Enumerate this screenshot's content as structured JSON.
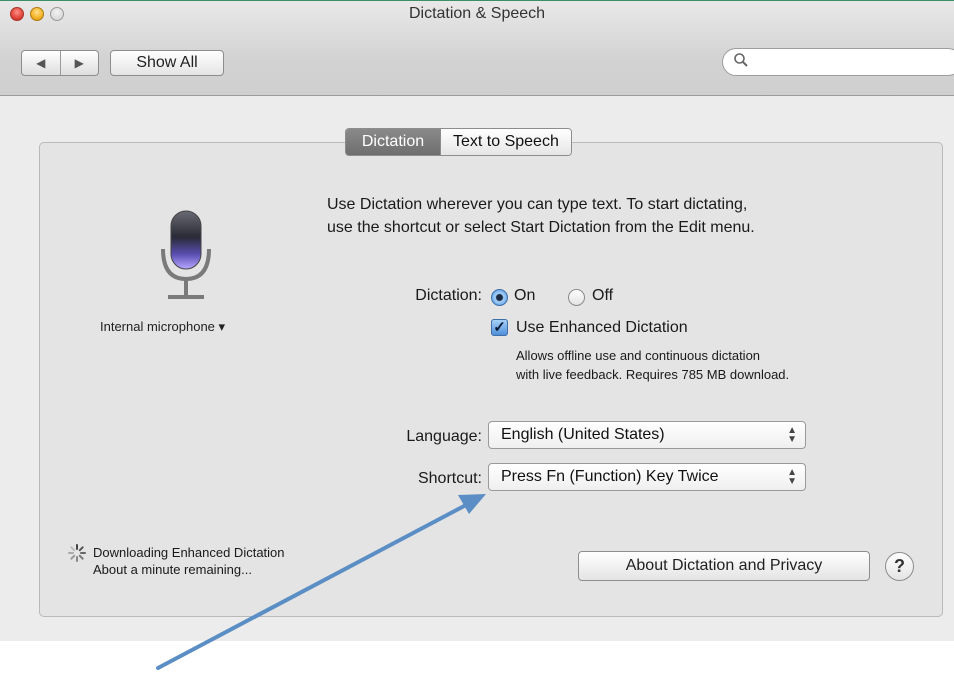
{
  "window": {
    "title": "Dictation & Speech",
    "nav_back_icon": "◀",
    "nav_forward_icon": "▶",
    "show_all_label": "Show All",
    "search": {
      "placeholder": "",
      "icon": "magnifier-icon"
    }
  },
  "tabs": [
    {
      "label": "Dictation",
      "selected": true
    },
    {
      "label": "Text to Speech",
      "selected": false
    }
  ],
  "dictation": {
    "description_line1": "Use Dictation wherever you can type text. To start dictating,",
    "description_line2": "use the shortcut or select Start Dictation from the Edit menu.",
    "microphone_label": "Internal microphone ▾",
    "dictation_label": "Dictation:",
    "on_label": "On",
    "off_label": "Off",
    "selected": "On",
    "enhanced_label": "Use Enhanced Dictation",
    "enhanced_checked": true,
    "enhanced_note_line1": "Allows offline use and continuous dictation",
    "enhanced_note_line2": "with live feedback. Requires 785 MB download.",
    "language_label": "Language:",
    "language_value": "English (United States)",
    "shortcut_label": "Shortcut:",
    "shortcut_value": "Press Fn (Function) Key Twice",
    "status_line1": "Downloading Enhanced Dictation",
    "status_line2": "About a minute remaining...",
    "about_button": "About Dictation and Privacy",
    "help_button": "?"
  },
  "colors": {
    "annotation_arrow": "#5b8ec4",
    "selected_tab": "#7a7a7a"
  }
}
